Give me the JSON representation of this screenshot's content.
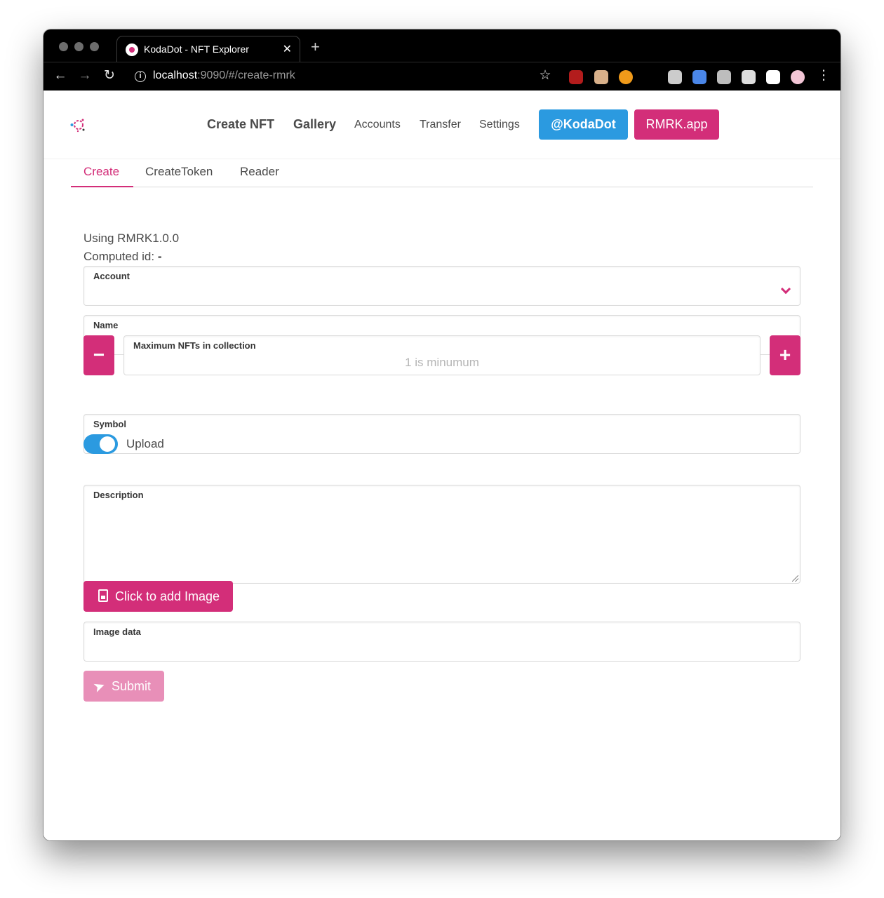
{
  "browser": {
    "tab_title": "KodaDot - NFT Explorer",
    "tab_close": "✕",
    "new_tab": "+",
    "url_host": "localhost",
    "url_rest": ":9090/#/create-rmrk",
    "nav": {
      "back": "←",
      "forward": "→",
      "reload": "↻",
      "star": "☆",
      "menu": "⋮",
      "info": "i"
    },
    "extensions": [
      {
        "name": "ublock-icon",
        "color": "#b31c1c"
      },
      {
        "name": "pixel-face-icon",
        "color": "#d8b08a"
      },
      {
        "name": "coin-icon",
        "color": "#f09a1a"
      },
      {
        "name": "layers-icon",
        "color": "#cccccc"
      },
      {
        "name": "translate-icon",
        "color": "#4a86e8"
      },
      {
        "name": "cube-icon",
        "color": "#bdbdbd"
      },
      {
        "name": "stormtrooper-icon",
        "color": "#dddddd"
      },
      {
        "name": "puzzle-icon",
        "color": "#ffffff"
      },
      {
        "name": "profile-avatar-icon",
        "color": "#f3c6d6"
      }
    ]
  },
  "navbar": {
    "items": [
      {
        "label": "Create NFT",
        "strong": true
      },
      {
        "label": "Gallery",
        "strong": true
      },
      {
        "label": "Accounts",
        "strong": false
      },
      {
        "label": "Transfer",
        "strong": false
      },
      {
        "label": "Settings",
        "strong": false
      }
    ],
    "koda_button": "@KodaDot",
    "rmrk_button": "RMRK.app"
  },
  "tabs": [
    {
      "label": "Create",
      "active": true
    },
    {
      "label": "CreateToken",
      "active": false
    },
    {
      "label": "Reader",
      "active": false
    }
  ],
  "form": {
    "using": "Using RMRK1.0.0",
    "computed_label": "Computed id:",
    "computed_value": "-",
    "account_label": "Account",
    "name_label": "Name",
    "max_label": "Maximum NFTs in collection",
    "max_placeholder": "1 is minumum",
    "minus": "−",
    "plus": "+",
    "symbol_label": "Symbol",
    "upload_label": "Upload",
    "upload_on": true,
    "description_label": "Description",
    "add_image": "Click to add Image",
    "image_data_label": "Image data",
    "submit": "Submit"
  },
  "colors": {
    "accent": "#d32e79",
    "blue": "#2b9ae0",
    "submit_disabled": "#e88fb8"
  }
}
